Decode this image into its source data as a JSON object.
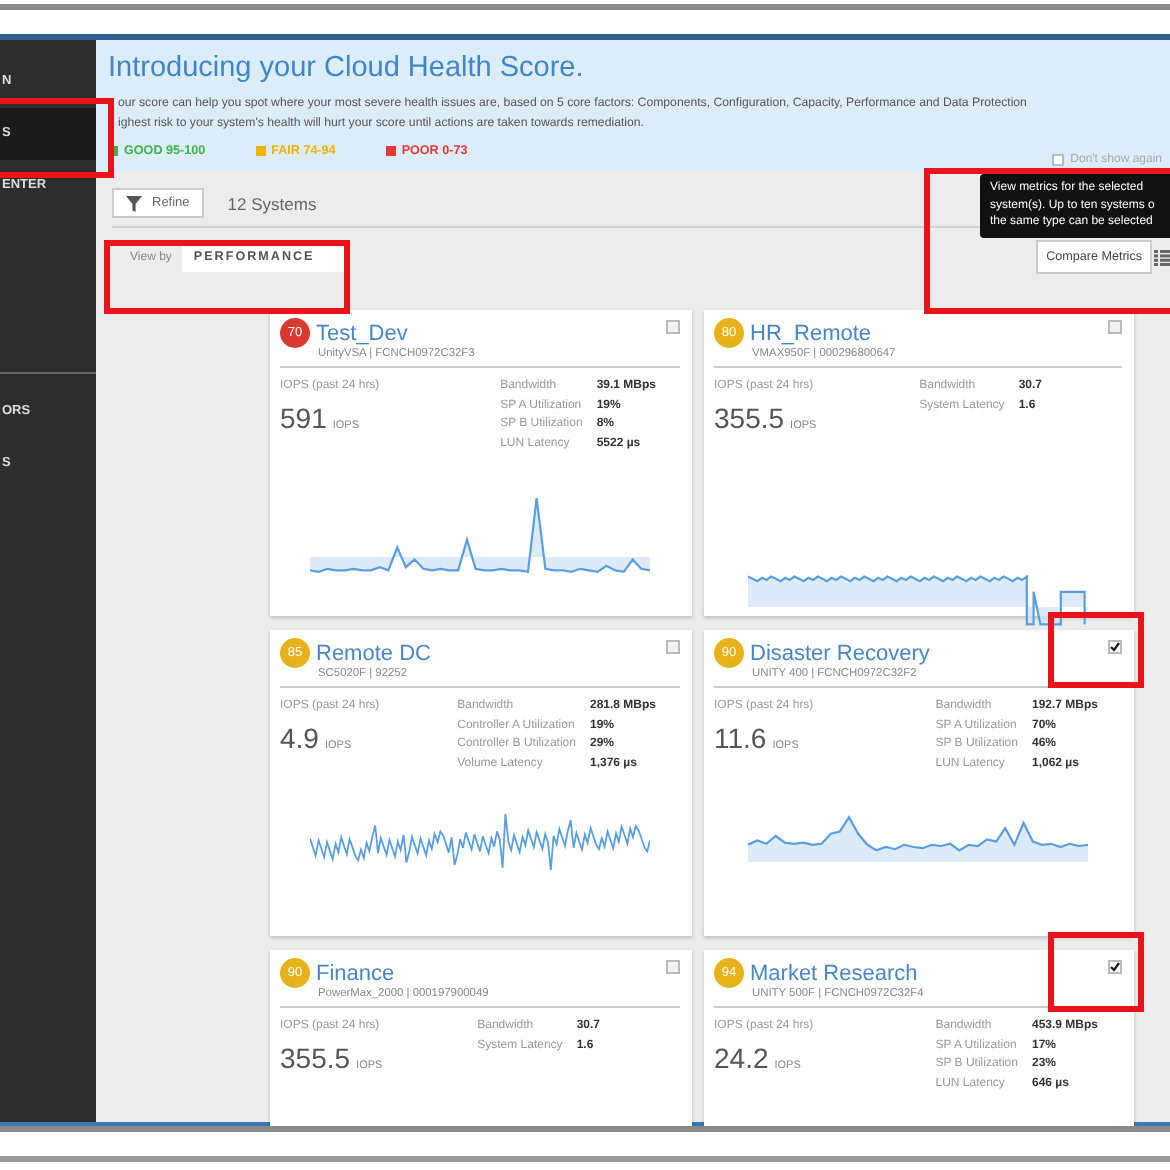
{
  "sidebar": {
    "sections": [
      {
        "items": [
          {
            "label": "N",
            "selected": false
          },
          {
            "label": "S",
            "selected": true
          },
          {
            "label": "ENTER",
            "selected": false
          }
        ]
      },
      {
        "items": [
          {
            "label": "ORS",
            "selected": false
          },
          {
            "label": "S",
            "selected": false
          }
        ]
      }
    ]
  },
  "banner": {
    "title": "Introducing your Cloud Health Score.",
    "lines": [
      "our score can help you spot where your most severe health issues are, based on 5 core factors: Components, Configuration, Capacity, Performance and Data Protection",
      "ighest risk to your system's health will hurt your score until actions are taken towards remediation."
    ],
    "legend": [
      {
        "label": "GOOD 95-100",
        "color": "#3cb44b"
      },
      {
        "label": "FAIR 74-94",
        "color": "#f0b400"
      },
      {
        "label": "POOR 0-73",
        "color": "#e03a3a"
      }
    ],
    "dismiss": {
      "label": "Don't show again",
      "checked": false
    }
  },
  "toolbar": {
    "refine": "Refine",
    "count": "12 Systems",
    "view_by_label": "View by",
    "view_by_value": "PERFORMANCE",
    "tooltip": [
      "View metrics for the selected",
      "system(s). Up to ten systems o",
      "the same type can be selected"
    ],
    "compare": "Compare Metrics"
  },
  "systems": [
    {
      "score": "70",
      "color": "#d93a2e",
      "name": "Test_Dev",
      "model": "UnityVSA | FCNCH0972C32F3",
      "iops_label": "IOPS (past 24 hrs)",
      "iops": "591",
      "unit": "IOPS",
      "selected": false,
      "metrics": [
        {
          "label": "Bandwidth",
          "value": "39.1 MBps"
        },
        {
          "label": "SP A Utilization",
          "value": "19%"
        },
        {
          "label": "SP B Utilization",
          "value": "8%"
        },
        {
          "label": "LUN Latency",
          "value": "5522 µs"
        }
      ]
    },
    {
      "score": "80",
      "color": "#e8b21a",
      "name": "HR_Remote",
      "model": "VMAX950F | 000296800647",
      "iops_label": "IOPS (past 24 hrs)",
      "iops": "355.5",
      "unit": "IOPS",
      "selected": false,
      "metrics": [
        {
          "label": "Bandwidth",
          "value": "30.7"
        },
        {
          "label": "System Latency",
          "value": "1.6"
        }
      ]
    },
    {
      "score": "85",
      "color": "#e8b21a",
      "name": "Remote DC",
      "model": "SC5020F | 92252",
      "iops_label": "IOPS (past 24 hrs)",
      "iops": "4.9",
      "unit": "IOPS",
      "selected": false,
      "metrics": [
        {
          "label": "Bandwidth",
          "value": "281.8 MBps"
        },
        {
          "label": "Controller A Utilization",
          "value": "19%"
        },
        {
          "label": "Controller B Utilization",
          "value": "29%"
        },
        {
          "label": "Volume Latency",
          "value": "1,376 µs"
        }
      ]
    },
    {
      "score": "90",
      "color": "#e8b21a",
      "name": "Disaster Recovery",
      "model": "UNITY 400 | FCNCH0972C32F2",
      "iops_label": "IOPS (past 24 hrs)",
      "iops": "11.6",
      "unit": "IOPS",
      "selected": true,
      "metrics": [
        {
          "label": "Bandwidth",
          "value": "192.7 MBps"
        },
        {
          "label": "SP A Utilization",
          "value": "70%"
        },
        {
          "label": "SP B Utilization",
          "value": "46%"
        },
        {
          "label": "LUN Latency",
          "value": "1,062 µs"
        }
      ]
    },
    {
      "score": "90",
      "color": "#e8b21a",
      "name": "Finance",
      "model": "PowerMax_2000 | 000197900049",
      "iops_label": "IOPS (past 24 hrs)",
      "iops": "355.5",
      "unit": "IOPS",
      "selected": false,
      "metrics": [
        {
          "label": "Bandwidth",
          "value": "30.7"
        },
        {
          "label": "System Latency",
          "value": "1.6"
        }
      ]
    },
    {
      "score": "94",
      "color": "#e8b21a",
      "name": "Market Research",
      "model": "UNITY 500F | FCNCH0972C32F4",
      "iops_label": "IOPS (past 24 hrs)",
      "iops": "24.2",
      "unit": "IOPS",
      "selected": true,
      "metrics": [
        {
          "label": "Bandwidth",
          "value": "453.9 MBps"
        },
        {
          "label": "SP A Utilization",
          "value": "17%"
        },
        {
          "label": "SP B Utilization",
          "value": "23%"
        },
        {
          "label": "LUN Latency",
          "value": "646 µs"
        }
      ]
    }
  ]
}
